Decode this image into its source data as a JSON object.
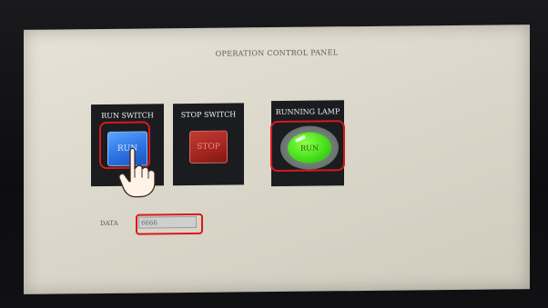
{
  "panel": {
    "title": "OPERATION CONTROL PANEL"
  },
  "run_switch": {
    "label": "RUN SWITCH",
    "button_text": "RUN"
  },
  "stop_switch": {
    "label": "STOP SWITCH",
    "button_text": "STOP"
  },
  "running_lamp": {
    "label": "RUNNING LAMP",
    "lamp_text": "RUN",
    "state": "on"
  },
  "data": {
    "label": "DATA",
    "value": "6666"
  },
  "colors": {
    "highlight": "#d7191e",
    "run_button": "#2a6fe0",
    "stop_button": "#9b211c",
    "lamp_on": "#46e01a",
    "screen_bg": "#dcd8cb"
  },
  "icons": {
    "pointer": "hand-pointer-icon"
  }
}
